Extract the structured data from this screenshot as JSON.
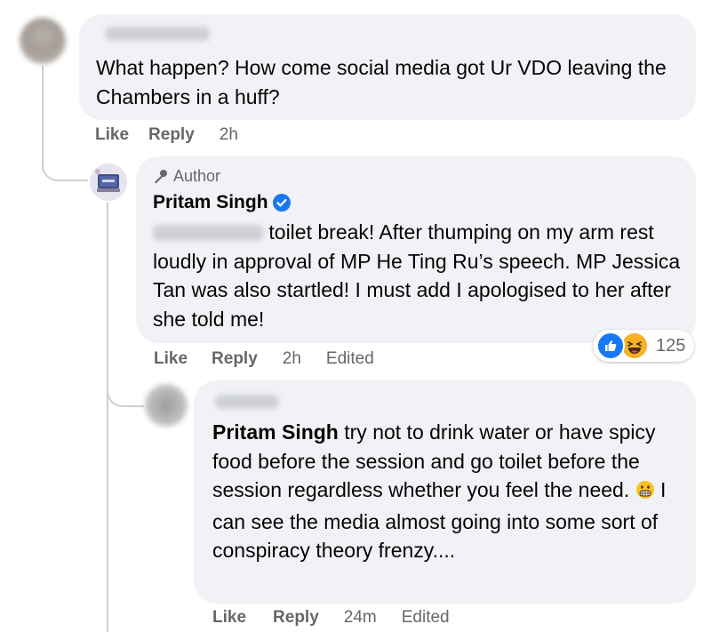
{
  "comments": [
    {
      "message": "What happen? How come social media got Ur VDO leaving the Chambers in a huff?",
      "actions": {
        "like": "Like",
        "reply": "Reply",
        "time": "2h"
      }
    },
    {
      "author_badge": "Author",
      "name": "Pritam Singh",
      "verified": true,
      "message_line1": "toilet break! After thumping on my",
      "message_rest": "arm rest loudly in approval of MP He Ting Ru’s speech. MP Jessica Tan was also startled! I must add I apologised to her after she told me!",
      "actions": {
        "like": "Like",
        "reply": "Reply",
        "time": "2h",
        "edited": "Edited"
      },
      "reactions": {
        "count": "125",
        "icons": [
          "like-icon",
          "haha-icon"
        ]
      }
    },
    {
      "mention": "Pritam Singh",
      "message_start": " try not to drink water or have spicy food before the session and go toilet before the session regardless whether you feel the need. ",
      "emoji": "grimace-emoji",
      "message_end": " I can see the media almost going into some sort of conspiracy theory frenzy....",
      "actions": {
        "like": "Like",
        "reply": "Reply",
        "time": "24m",
        "edited": "Edited"
      }
    }
  ],
  "colors": {
    "bubble": "#f0f2f5",
    "text": "#050505",
    "secondary": "#65676b",
    "verified": "#1877f2",
    "like": "#1877f2",
    "haha": "#f7b125"
  }
}
